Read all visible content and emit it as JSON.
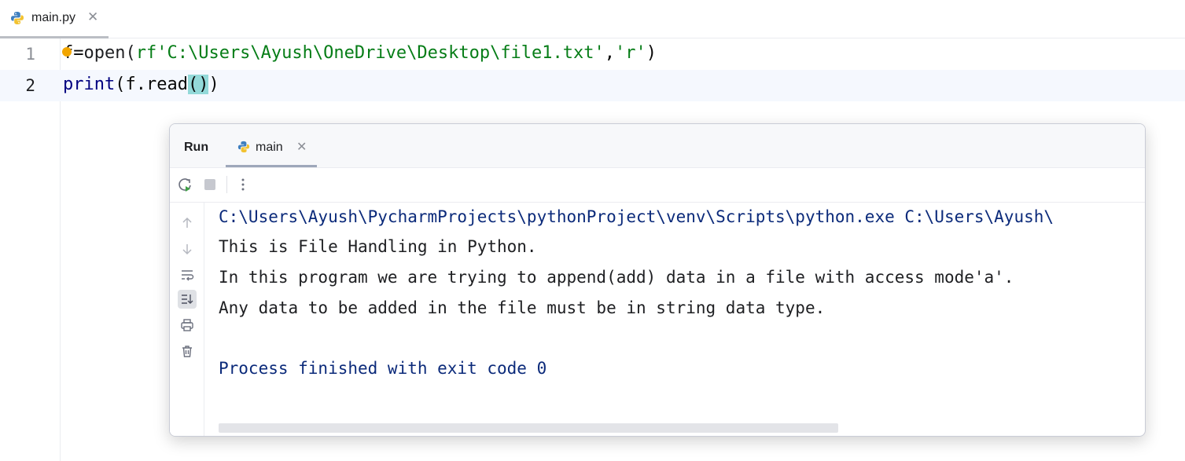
{
  "editor": {
    "tab": {
      "filename": "main.py",
      "close": "✕"
    },
    "lines": [
      {
        "num": "1",
        "seg_a": "f",
        "seg_b": "=",
        "seg_c": "open(",
        "seg_str1": "rf'C:\\Users\\Ayush\\OneDrive\\Desktop\\file1.txt'",
        "seg_d": ",",
        "seg_str2": "'r'",
        "seg_e": ")"
      },
      {
        "num": "2",
        "seg_a": "print",
        "seg_b": "(f.read",
        "seg_paren": "()",
        "seg_c": ")"
      }
    ]
  },
  "run": {
    "title": "Run",
    "tab": {
      "label": "main",
      "close": "✕"
    },
    "console": [
      "C:\\Users\\Ayush\\PycharmProjects\\pythonProject\\venv\\Scripts\\python.exe C:\\Users\\Ayush\\",
      "This is File Handling in Python.",
      "In this program we are trying to append(add) data in a file with access mode'a'.",
      "Any data to be added in the file must be in string data type.",
      "",
      "Process finished with exit code 0"
    ]
  },
  "icons": {
    "python": "python-icon",
    "rerun": "rerun-icon",
    "stop": "stop-icon",
    "more": "more-vertical-icon",
    "up": "arrow-up-icon",
    "down": "arrow-down-icon",
    "wrap": "soft-wrap-icon",
    "scroll_end": "scroll-to-end-icon",
    "print": "print-icon",
    "trash": "trash-icon"
  },
  "colors": {
    "string": "#067d17",
    "console_blue": "#0b2a7a",
    "paren_highlight": "#93d9d9",
    "bulb": "#f2a600"
  }
}
